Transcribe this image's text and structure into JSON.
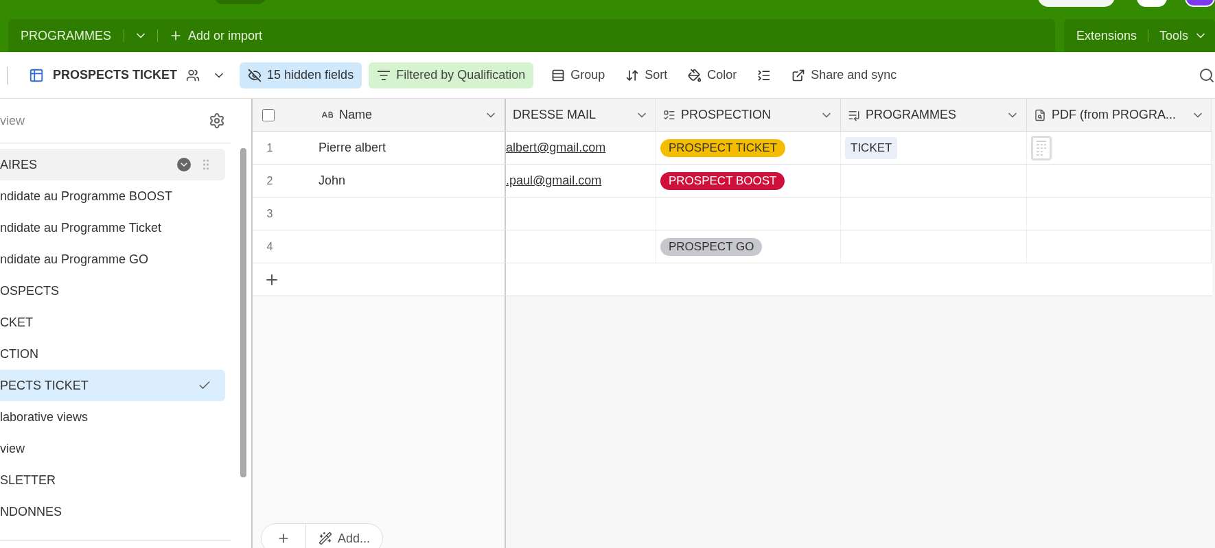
{
  "tab_bar": {
    "table_tab": "PROGRAMMES",
    "add_label": "Add or import",
    "right_items": [
      "Extensions",
      "Tools"
    ]
  },
  "toolbar": {
    "view_name": "PROSPECTS TICKET",
    "hidden_fields": "15 hidden fields",
    "filter": "Filtered by Qualification",
    "actions": [
      {
        "kind": "group",
        "label": "Group"
      },
      {
        "kind": "sort",
        "label": "Sort"
      },
      {
        "kind": "color",
        "label": "Color"
      },
      {
        "kind": "row-height"
      },
      {
        "kind": "share",
        "label": "Share and sync"
      }
    ]
  },
  "sidebar": {
    "search_placeholder": "view",
    "items": [
      {
        "label": "AIRES",
        "selected": false,
        "hovered": true
      },
      {
        "label": "ndidate au Programme BOOST",
        "selected": false,
        "hovered": false
      },
      {
        "label": "ndidate au Programme Ticket",
        "selected": false,
        "hovered": false
      },
      {
        "label": "ndidate au Programme GO",
        "selected": false,
        "hovered": false
      },
      {
        "label": "OSPECTS",
        "selected": false,
        "hovered": false
      },
      {
        "label": "CKET",
        "selected": false,
        "hovered": false
      },
      {
        "label": "CTION",
        "selected": false,
        "hovered": false
      },
      {
        "label": "PECTS TICKET",
        "selected": true,
        "hovered": false
      },
      {
        "label": "laborative views",
        "selected": false,
        "hovered": false
      },
      {
        "label": "view",
        "selected": false,
        "hovered": false
      },
      {
        "label": "SLETTER",
        "selected": false,
        "hovered": false
      },
      {
        "label": "NDONNES",
        "selected": false,
        "hovered": false
      }
    ]
  },
  "table": {
    "columns": [
      {
        "kind": "name",
        "label": "Name"
      },
      {
        "kind": "email",
        "label": "DRESSE MAIL"
      },
      {
        "kind": "select",
        "label": "PROSPECTION"
      },
      {
        "kind": "link",
        "label": "PROGRAMMES"
      },
      {
        "kind": "lookup",
        "label": "PDF (from PROGRA..."
      }
    ],
    "rows": [
      {
        "number": "1",
        "name": "Pierre albert",
        "email": "albert@gmail.com",
        "prospection": {
          "label": "PROSPECT TICKET",
          "color": "#f5bd00"
        },
        "programme": "TICKET",
        "attachment": true
      },
      {
        "number": "2",
        "name": "John",
        "email": ".paul@gmail.com",
        "prospection": {
          "label": "PROSPECT BOOST",
          "color": "#d0103a"
        },
        "attachment": false
      },
      {
        "number": "3",
        "attachment": false
      },
      {
        "number": "4",
        "prospection": {
          "label": "PROSPECT GO",
          "color": "#c7c8cd"
        },
        "attachment": false
      }
    ],
    "add_label": "Add...",
    "select_all_checked": false
  }
}
